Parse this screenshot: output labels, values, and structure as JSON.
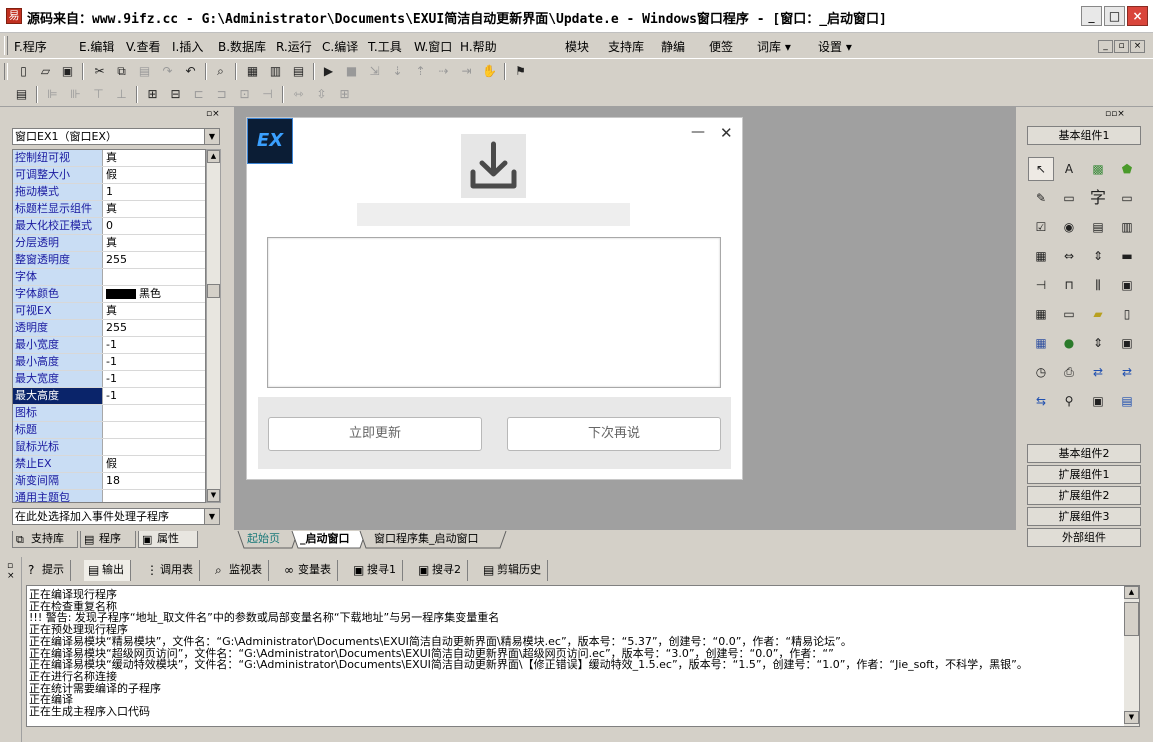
{
  "title_bar": {
    "text": "源码来自：www.9ifz.cc - G:\\Administrator\\Documents\\EXUI简洁自动更新界面\\Update.e - Windows窗口程序 - [窗口：_启动窗口]",
    "buttons": [
      "_",
      "□",
      "×"
    ]
  },
  "menu": {
    "items": [
      "F.程序",
      "E.编辑",
      "V.查看",
      "I.插入",
      "B.数据库",
      "R.运行",
      "C.编译",
      "T.工具",
      "W.窗口",
      "H.帮助",
      "模块",
      "支持库",
      "静编",
      "便签",
      "词库 ▾",
      "设置 ▾"
    ],
    "mdi_buttons": [
      "_",
      "▫",
      "×"
    ]
  },
  "toolbar1": [
    "new-icon",
    "open-icon",
    "save-icon",
    "cut-icon",
    "copy-icon",
    "paste-icon",
    "redo-icon",
    "undo-icon",
    "find-icon",
    "layout1-icon",
    "layout2-icon",
    "layout3-icon",
    "run-icon",
    "stop-icon",
    "step-icon",
    "step-into-icon",
    "step-out-icon",
    "step-over-icon",
    "run-to-icon",
    "hand-icon",
    "debug-icon"
  ],
  "left_panel": {
    "object_combo": "窗口EX1（窗口EX）",
    "properties": [
      {
        "name": "控制纽可视",
        "value": "真"
      },
      {
        "name": "可调整大小",
        "value": "假"
      },
      {
        "name": "拖动模式",
        "value": "1"
      },
      {
        "name": "标题栏显示组件",
        "value": "真"
      },
      {
        "name": "最大化校正模式",
        "value": "0"
      },
      {
        "name": "分层透明",
        "value": "真"
      },
      {
        "name": "整窗透明度",
        "value": "255"
      },
      {
        "name": "字体",
        "value": ""
      },
      {
        "name": "字体颜色",
        "value": "黑色"
      },
      {
        "name": "可视EX",
        "value": "真"
      },
      {
        "name": "透明度",
        "value": "255"
      },
      {
        "name": "最小宽度",
        "value": "-1"
      },
      {
        "name": "最小高度",
        "value": "-1"
      },
      {
        "name": "最大宽度",
        "value": "-1"
      },
      {
        "name": "最大高度",
        "value": "-1"
      },
      {
        "name": "图标",
        "value": ""
      },
      {
        "name": "标题",
        "value": ""
      },
      {
        "name": "鼠标光标",
        "value": ""
      },
      {
        "name": "禁止EX",
        "value": "假"
      },
      {
        "name": "渐变间隔",
        "value": "18"
      },
      {
        "name": "通用主题包",
        "value": ""
      }
    ],
    "event_combo": "在此处选择加入事件处理子程序",
    "tabs": [
      "支持库",
      "程序",
      "属性"
    ]
  },
  "form": {
    "logo_text": "EX",
    "minimize": "—",
    "close": "✕",
    "update_button": "立即更新",
    "later_button": "下次再说"
  },
  "doc_tabs": [
    "起始页",
    "_启动窗口",
    "窗口程序集_启动窗口"
  ],
  "right_panel": {
    "group_top": "基本组件1",
    "groups_bottom": [
      "基本组件2",
      "扩展组件1",
      "扩展组件2",
      "扩展组件3",
      "外部组件"
    ],
    "text_component": "字"
  },
  "bottom_tabs": [
    "提示",
    "输出",
    "调用表",
    "监视表",
    "变量表",
    "搜寻1",
    "搜寻2",
    "剪辑历史"
  ],
  "output_lines": [
    "正在编译现行程序",
    "正在检查重复名称",
    "!!! 警告: 发现子程序“地址_取文件名”中的参数或局部变量名称“下载地址”与另一程序集变量重名",
    "正在预处理现行程序",
    "正在编译易模块“精易模块”，文件名：“G:\\Administrator\\Documents\\EXUI简洁自动更新界面\\精易模块.ec”，版本号：“5.37”，创建号：“0.0”，作者：“精易论坛”。",
    "正在编译易模块“超级网页访问”，文件名：“G:\\Administrator\\Documents\\EXUI简洁自动更新界面\\超级网页访问.ec”，版本号：“3.0”，创建号：“0.0”，作者：“”",
    "正在编译易模块“缓动特效模块”，文件名：“G:\\Administrator\\Documents\\EXUI简洁自动更新界面\\【修正错误】缓动特效_1.5.ec”，版本号：“1.5”，创建号：“1.0”，作者：“Jie_soft，不科学，黑银”。",
    "正在进行名称连接",
    "正在统计需要编译的子程序",
    "正在编译",
    "正在生成主程序入口代码"
  ]
}
